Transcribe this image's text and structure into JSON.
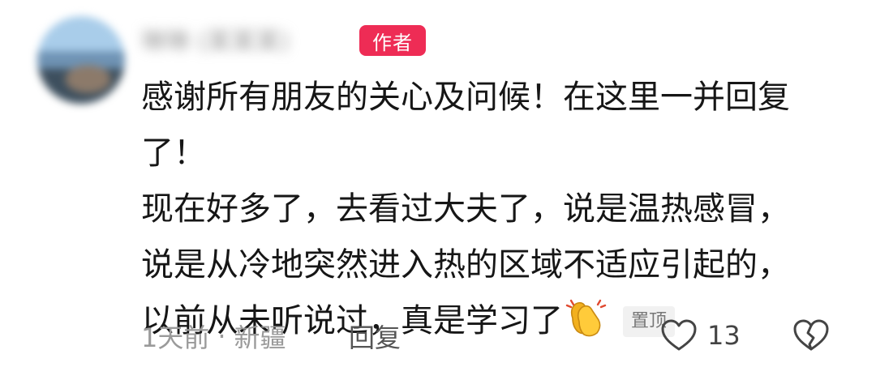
{
  "comment": {
    "author": {
      "name": "琳琳 (某某某)",
      "badge": "作者",
      "badge_color": "#ee2c55"
    },
    "lines": [
      "感谢所有朋友的关心及问候！在这里一并回复",
      "了！",
      "现在好多了，去看过大夫了，说是温热感冒，",
      "说是从冷地突然进入热的区域不适应引起的，",
      "以前从未听说过，真是学习了"
    ],
    "emoji": "clapping-hands-icon",
    "pin_label": "置顶",
    "meta": {
      "time": "1天前",
      "separator": "·",
      "location": "新疆"
    },
    "reply_label": "回复",
    "like_count": "13",
    "icons": {
      "like": "heart-outline-icon",
      "dislike": "broken-heart-icon"
    }
  }
}
